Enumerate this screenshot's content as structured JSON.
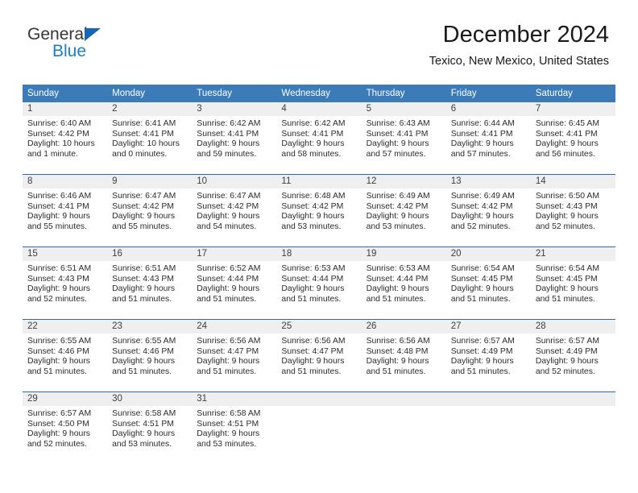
{
  "brand": {
    "name_part1": "General",
    "name_part2": "Blue",
    "accent_color": "#1a7dc8",
    "triangle_color": "#1567b5"
  },
  "header": {
    "title": "December 2024",
    "location": "Texico, New Mexico, United States"
  },
  "theme": {
    "header_row_bg": "#3b7cb8",
    "row_divider": "#2a6ca8",
    "daynum_band_bg": "#efefef",
    "text_color": "#2b2b2b"
  },
  "columns": [
    "Sunday",
    "Monday",
    "Tuesday",
    "Wednesday",
    "Thursday",
    "Friday",
    "Saturday"
  ],
  "weeks": [
    [
      {
        "day": "1",
        "sunrise": "Sunrise: 6:40 AM",
        "sunset": "Sunset: 4:42 PM",
        "daylight_line1": "Daylight: 10 hours",
        "daylight_line2": "and 1 minute."
      },
      {
        "day": "2",
        "sunrise": "Sunrise: 6:41 AM",
        "sunset": "Sunset: 4:41 PM",
        "daylight_line1": "Daylight: 10 hours",
        "daylight_line2": "and 0 minutes."
      },
      {
        "day": "3",
        "sunrise": "Sunrise: 6:42 AM",
        "sunset": "Sunset: 4:41 PM",
        "daylight_line1": "Daylight: 9 hours",
        "daylight_line2": "and 59 minutes."
      },
      {
        "day": "4",
        "sunrise": "Sunrise: 6:42 AM",
        "sunset": "Sunset: 4:41 PM",
        "daylight_line1": "Daylight: 9 hours",
        "daylight_line2": "and 58 minutes."
      },
      {
        "day": "5",
        "sunrise": "Sunrise: 6:43 AM",
        "sunset": "Sunset: 4:41 PM",
        "daylight_line1": "Daylight: 9 hours",
        "daylight_line2": "and 57 minutes."
      },
      {
        "day": "6",
        "sunrise": "Sunrise: 6:44 AM",
        "sunset": "Sunset: 4:41 PM",
        "daylight_line1": "Daylight: 9 hours",
        "daylight_line2": "and 57 minutes."
      },
      {
        "day": "7",
        "sunrise": "Sunrise: 6:45 AM",
        "sunset": "Sunset: 4:41 PM",
        "daylight_line1": "Daylight: 9 hours",
        "daylight_line2": "and 56 minutes."
      }
    ],
    [
      {
        "day": "8",
        "sunrise": "Sunrise: 6:46 AM",
        "sunset": "Sunset: 4:41 PM",
        "daylight_line1": "Daylight: 9 hours",
        "daylight_line2": "and 55 minutes."
      },
      {
        "day": "9",
        "sunrise": "Sunrise: 6:47 AM",
        "sunset": "Sunset: 4:42 PM",
        "daylight_line1": "Daylight: 9 hours",
        "daylight_line2": "and 55 minutes."
      },
      {
        "day": "10",
        "sunrise": "Sunrise: 6:47 AM",
        "sunset": "Sunset: 4:42 PM",
        "daylight_line1": "Daylight: 9 hours",
        "daylight_line2": "and 54 minutes."
      },
      {
        "day": "11",
        "sunrise": "Sunrise: 6:48 AM",
        "sunset": "Sunset: 4:42 PM",
        "daylight_line1": "Daylight: 9 hours",
        "daylight_line2": "and 53 minutes."
      },
      {
        "day": "12",
        "sunrise": "Sunrise: 6:49 AM",
        "sunset": "Sunset: 4:42 PM",
        "daylight_line1": "Daylight: 9 hours",
        "daylight_line2": "and 53 minutes."
      },
      {
        "day": "13",
        "sunrise": "Sunrise: 6:49 AM",
        "sunset": "Sunset: 4:42 PM",
        "daylight_line1": "Daylight: 9 hours",
        "daylight_line2": "and 52 minutes."
      },
      {
        "day": "14",
        "sunrise": "Sunrise: 6:50 AM",
        "sunset": "Sunset: 4:43 PM",
        "daylight_line1": "Daylight: 9 hours",
        "daylight_line2": "and 52 minutes."
      }
    ],
    [
      {
        "day": "15",
        "sunrise": "Sunrise: 6:51 AM",
        "sunset": "Sunset: 4:43 PM",
        "daylight_line1": "Daylight: 9 hours",
        "daylight_line2": "and 52 minutes."
      },
      {
        "day": "16",
        "sunrise": "Sunrise: 6:51 AM",
        "sunset": "Sunset: 4:43 PM",
        "daylight_line1": "Daylight: 9 hours",
        "daylight_line2": "and 51 minutes."
      },
      {
        "day": "17",
        "sunrise": "Sunrise: 6:52 AM",
        "sunset": "Sunset: 4:44 PM",
        "daylight_line1": "Daylight: 9 hours",
        "daylight_line2": "and 51 minutes."
      },
      {
        "day": "18",
        "sunrise": "Sunrise: 6:53 AM",
        "sunset": "Sunset: 4:44 PM",
        "daylight_line1": "Daylight: 9 hours",
        "daylight_line2": "and 51 minutes."
      },
      {
        "day": "19",
        "sunrise": "Sunrise: 6:53 AM",
        "sunset": "Sunset: 4:44 PM",
        "daylight_line1": "Daylight: 9 hours",
        "daylight_line2": "and 51 minutes."
      },
      {
        "day": "20",
        "sunrise": "Sunrise: 6:54 AM",
        "sunset": "Sunset: 4:45 PM",
        "daylight_line1": "Daylight: 9 hours",
        "daylight_line2": "and 51 minutes."
      },
      {
        "day": "21",
        "sunrise": "Sunrise: 6:54 AM",
        "sunset": "Sunset: 4:45 PM",
        "daylight_line1": "Daylight: 9 hours",
        "daylight_line2": "and 51 minutes."
      }
    ],
    [
      {
        "day": "22",
        "sunrise": "Sunrise: 6:55 AM",
        "sunset": "Sunset: 4:46 PM",
        "daylight_line1": "Daylight: 9 hours",
        "daylight_line2": "and 51 minutes."
      },
      {
        "day": "23",
        "sunrise": "Sunrise: 6:55 AM",
        "sunset": "Sunset: 4:46 PM",
        "daylight_line1": "Daylight: 9 hours",
        "daylight_line2": "and 51 minutes."
      },
      {
        "day": "24",
        "sunrise": "Sunrise: 6:56 AM",
        "sunset": "Sunset: 4:47 PM",
        "daylight_line1": "Daylight: 9 hours",
        "daylight_line2": "and 51 minutes."
      },
      {
        "day": "25",
        "sunrise": "Sunrise: 6:56 AM",
        "sunset": "Sunset: 4:47 PM",
        "daylight_line1": "Daylight: 9 hours",
        "daylight_line2": "and 51 minutes."
      },
      {
        "day": "26",
        "sunrise": "Sunrise: 6:56 AM",
        "sunset": "Sunset: 4:48 PM",
        "daylight_line1": "Daylight: 9 hours",
        "daylight_line2": "and 51 minutes."
      },
      {
        "day": "27",
        "sunrise": "Sunrise: 6:57 AM",
        "sunset": "Sunset: 4:49 PM",
        "daylight_line1": "Daylight: 9 hours",
        "daylight_line2": "and 51 minutes."
      },
      {
        "day": "28",
        "sunrise": "Sunrise: 6:57 AM",
        "sunset": "Sunset: 4:49 PM",
        "daylight_line1": "Daylight: 9 hours",
        "daylight_line2": "and 52 minutes."
      }
    ],
    [
      {
        "day": "29",
        "sunrise": "Sunrise: 6:57 AM",
        "sunset": "Sunset: 4:50 PM",
        "daylight_line1": "Daylight: 9 hours",
        "daylight_line2": "and 52 minutes."
      },
      {
        "day": "30",
        "sunrise": "Sunrise: 6:58 AM",
        "sunset": "Sunset: 4:51 PM",
        "daylight_line1": "Daylight: 9 hours",
        "daylight_line2": "and 53 minutes."
      },
      {
        "day": "31",
        "sunrise": "Sunrise: 6:58 AM",
        "sunset": "Sunset: 4:51 PM",
        "daylight_line1": "Daylight: 9 hours",
        "daylight_line2": "and 53 minutes."
      },
      {
        "day": "",
        "sunrise": "",
        "sunset": "",
        "daylight_line1": "",
        "daylight_line2": ""
      },
      {
        "day": "",
        "sunrise": "",
        "sunset": "",
        "daylight_line1": "",
        "daylight_line2": ""
      },
      {
        "day": "",
        "sunrise": "",
        "sunset": "",
        "daylight_line1": "",
        "daylight_line2": ""
      },
      {
        "day": "",
        "sunrise": "",
        "sunset": "",
        "daylight_line1": "",
        "daylight_line2": ""
      }
    ]
  ]
}
